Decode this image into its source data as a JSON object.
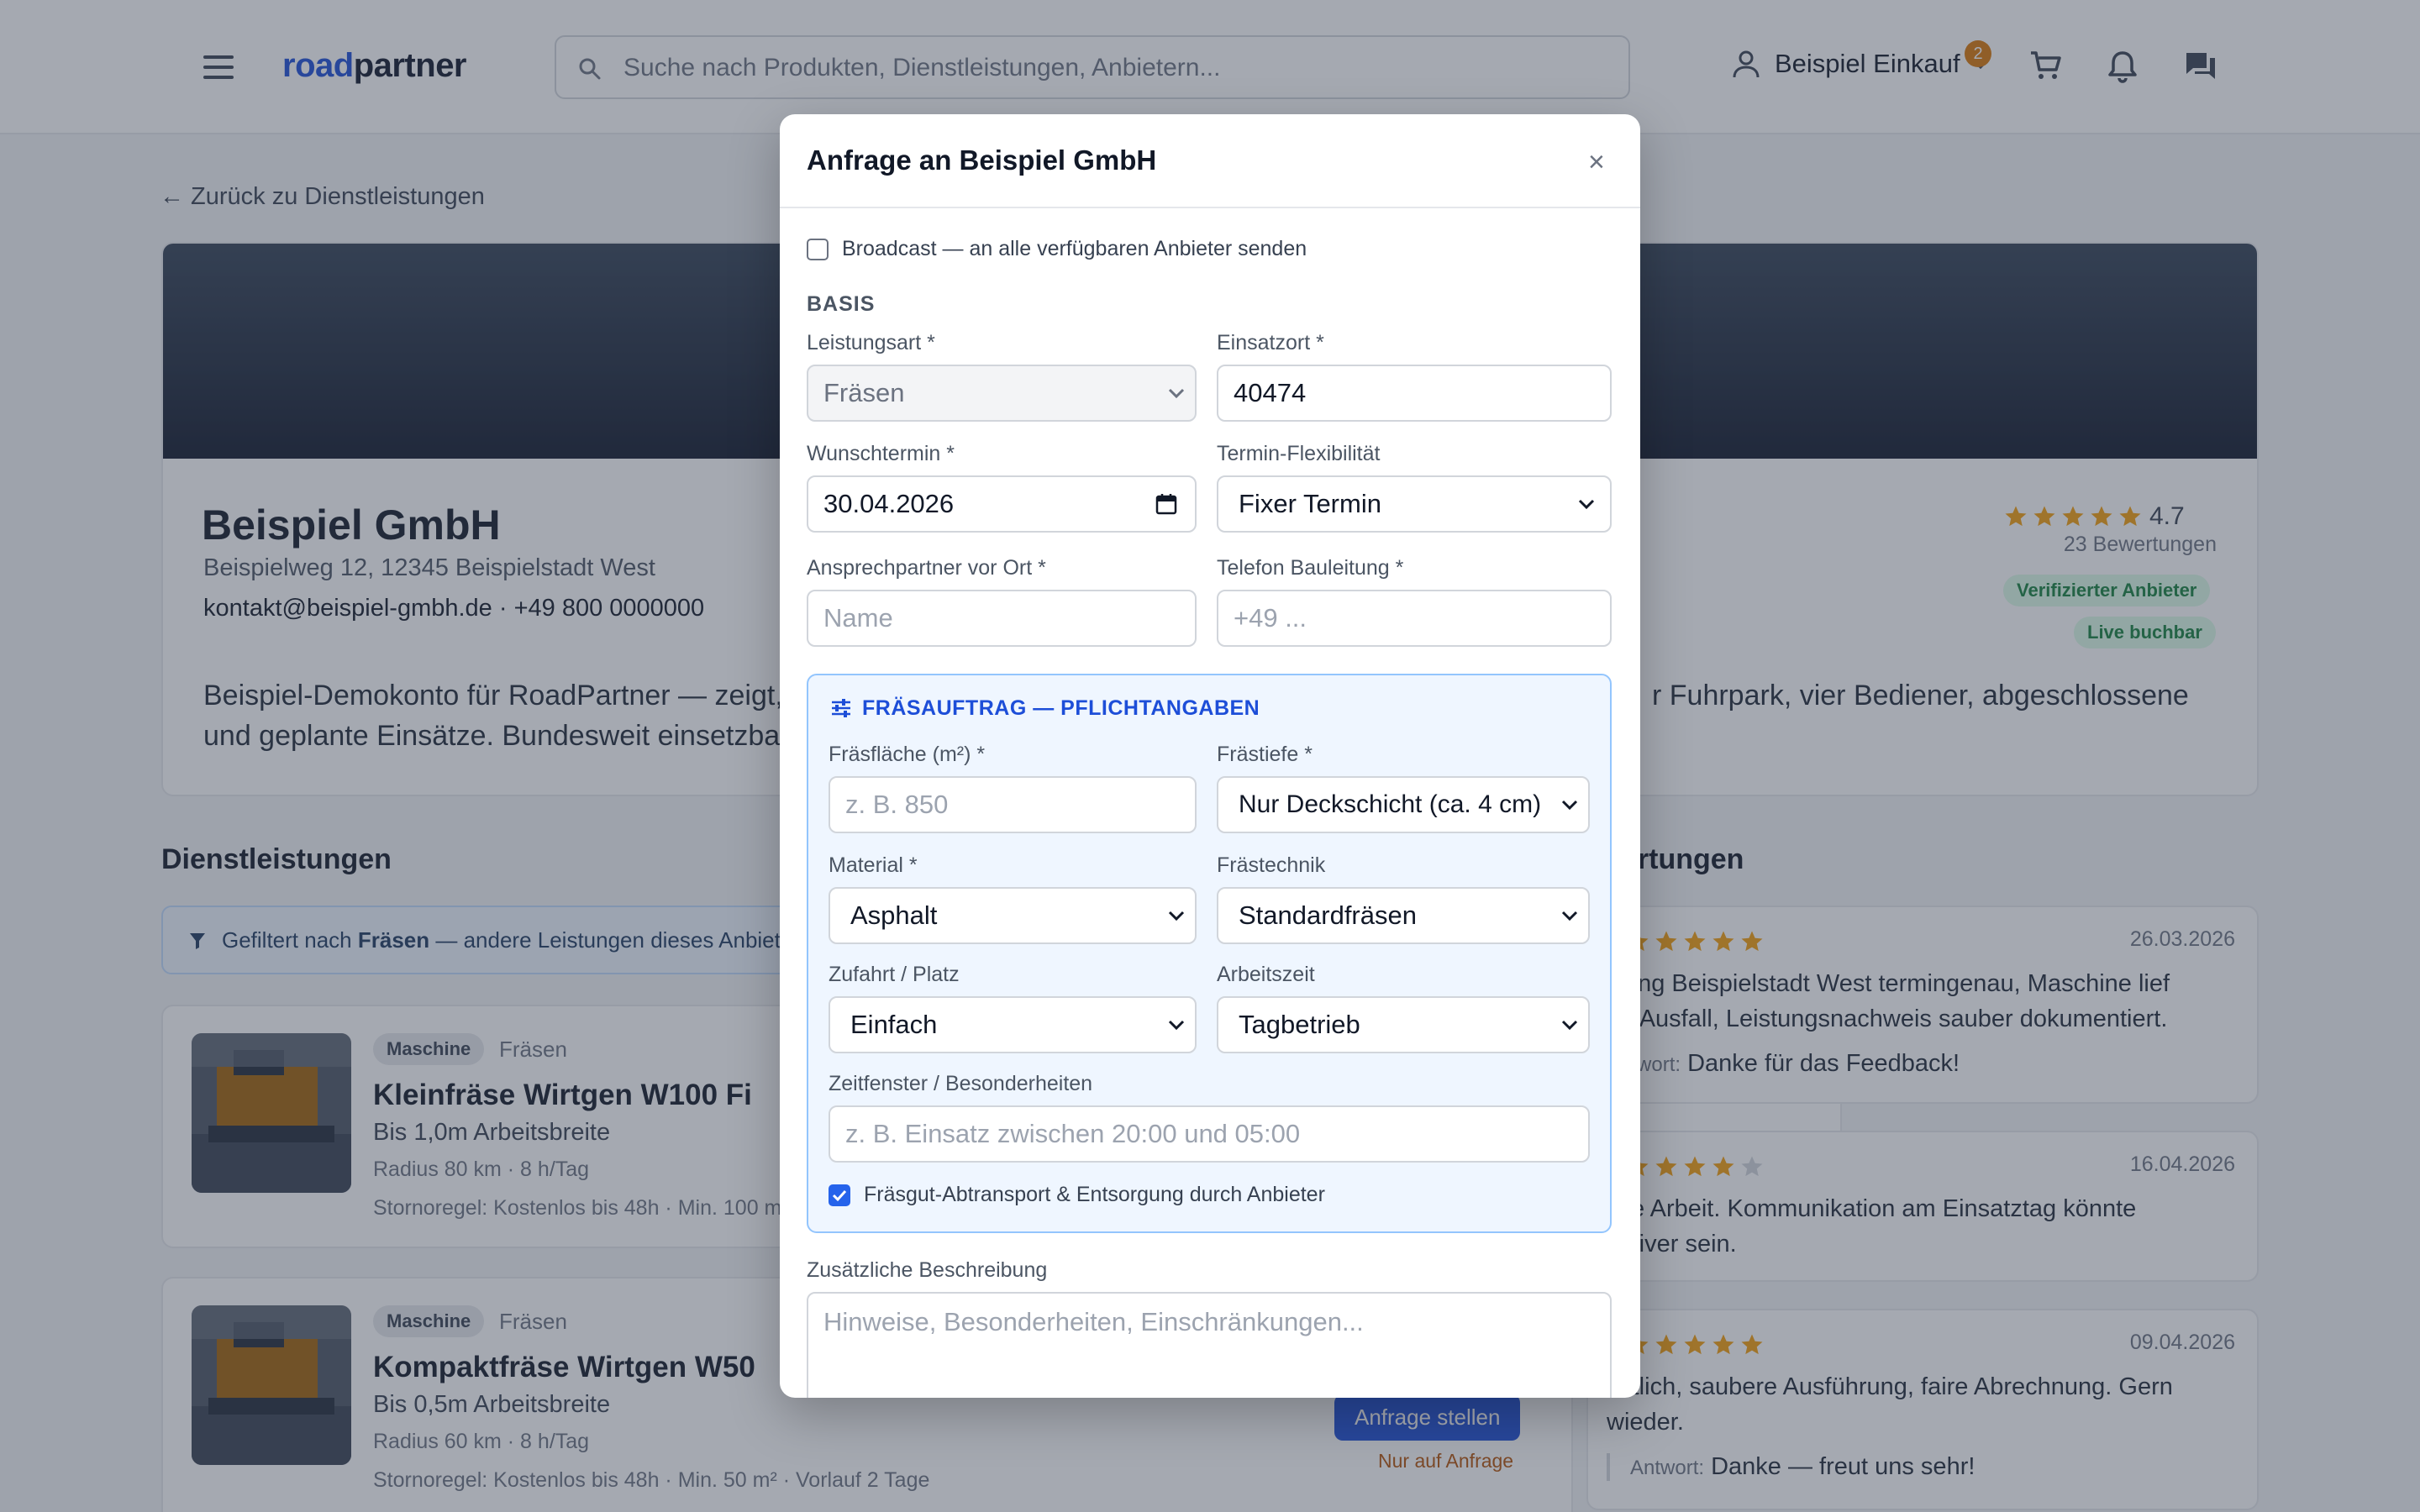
{
  "header": {
    "logo_part1": "road",
    "logo_part2": "partner",
    "search_placeholder": "Suche nach Produkten, Dienstleistungen, Anbietern...",
    "user_name": "Beispiel Einkauf",
    "cart_badge": "2",
    "icons": [
      "menu-icon",
      "search-icon",
      "user-icon",
      "chevron-down-icon",
      "cart-icon",
      "bell-icon",
      "chat-icon"
    ]
  },
  "page": {
    "back_link": "← Zurück zu Dienstleistungen",
    "company_name": "Beispiel GmbH",
    "address": "Beispielweg 12, 12345 Beispielstadt West",
    "contact": "kontakt@beispiel-gmbh.de · +49 800 0000000",
    "description_line1_left": "Beispiel-Demokonto für RoadPartner — zeigt,",
    "description_line1_right": "r Fuhrpark, vier Bediener, abgeschlossene",
    "description_line2_left": "und geplante Einsätze. Bundesweit einsetzba",
    "rating_value": "4.7",
    "rating_stars": 4.7,
    "rating_count": "23 Bewertungen",
    "badge_verified": "Verifizierter Anbieter",
    "badge_live": "Live buchbar",
    "accent_color": "#1d4ed8",
    "star_color": "#f59e0b"
  },
  "services": {
    "title": "Dienstleistungen",
    "filter_prefix": "Gefiltert nach ",
    "filter_bold": "Fräsen",
    "filter_suffix": " — andere Leistungen dieses Anbieter",
    "items": [
      {
        "tag": "Maschine",
        "category": "Fräsen",
        "title": "Kleinfräse Wirtgen W100 Fi",
        "subtitle": "Bis 1,0m Arbeitsbreite",
        "meta": "Radius 80 km · 8 h/Tag",
        "storno": "Stornoregel: Kostenlos bis 48h · Min. 100 m"
      },
      {
        "tag": "Maschine",
        "category": "Fräsen",
        "title": "Kompaktfräse Wirtgen W50",
        "subtitle": "Bis 0,5m Arbeitsbreite",
        "meta": "Radius 60 km · 8 h/Tag",
        "storno": "Stornoregel: Kostenlos bis 48h · Min. 50 m² · Vorlauf 2 Tage",
        "button": "Anfrage stellen",
        "note": "Nur auf Anfrage"
      }
    ]
  },
  "reviews": {
    "title_fragment": "ertungen",
    "answer_label": "Antwort:",
    "items": [
      {
        "stars": 5,
        "date": "26.03.2026",
        "line1": "isung Beispielstadt West termingenau, Maschine lief",
        "line2": "ne Ausfall, Leistungsnachweis sauber dokumentiert.",
        "answer": "Danke für das Feedback!",
        "answer_label": "Antwort:"
      },
      {
        "stars": 4,
        "date": "16.04.2026",
        "line1": "lide Arbeit. Kommunikation am Einsatztag könnte",
        "line2": "aktiver sein."
      },
      {
        "stars": 5,
        "date": "09.04.2026",
        "line1": "nktlich, saubere Ausführung, faire Abrechnung. Gern",
        "line2": "wieder.",
        "answer": "Danke — freut uns sehr!",
        "answer_label": "Antwort:"
      }
    ]
  },
  "modal": {
    "title": "Anfrage an Beispiel GmbH",
    "close": "×",
    "broadcast_label": "Broadcast — an alle verfügbaren Anbieter senden",
    "broadcast_checked": false,
    "section_basis": "BASIS",
    "leistungsart_label": "Leistungsart *",
    "leistungsart_value": "Fräsen",
    "einsatzort_label": "Einsatzort *",
    "einsatzort_value": "40474",
    "wunschtermin_label": "Wunschtermin *",
    "wunschtermin_value": "30.04.2026",
    "flex_label": "Termin-Flexibilität",
    "flex_value": "Fixer Termin",
    "ansprech_label": "Ansprechpartner vor Ort *",
    "ansprech_placeholder": "Name",
    "telefon_label": "Telefon Bauleitung *",
    "telefon_placeholder": "+49 ...",
    "fr_title": "FRÄSAUFTRAG — PFLICHTANGABEN",
    "flaeche_label": "Fräsfläche (m²) *",
    "flaeche_placeholder": "z. B. 850",
    "tiefe_label": "Frästiefe *",
    "tiefe_value": "Nur Deckschicht (ca. 4 cm)",
    "material_label": "Material *",
    "material_value": "Asphalt",
    "technik_label": "Frästechnik",
    "technik_value": "Standardfräsen",
    "zufahrt_label": "Zufahrt / Platz",
    "zufahrt_value": "Einfach",
    "arbeitszeit_label": "Arbeitszeit",
    "arbeitszeit_value": "Tagbetrieb",
    "zeitfenster_label": "Zeitfenster / Besonderheiten",
    "zeitfenster_placeholder": "z. B. Einsatz zwischen 20:00 und 05:00",
    "abtransport_label": "Fräsgut-Abtransport & Entsorgung durch Anbieter",
    "abtransport_checked": true,
    "beschreibung_label": "Zusätzliche Beschreibung",
    "beschreibung_placeholder": "Hinweise, Besonderheiten, Einschränkungen..."
  }
}
